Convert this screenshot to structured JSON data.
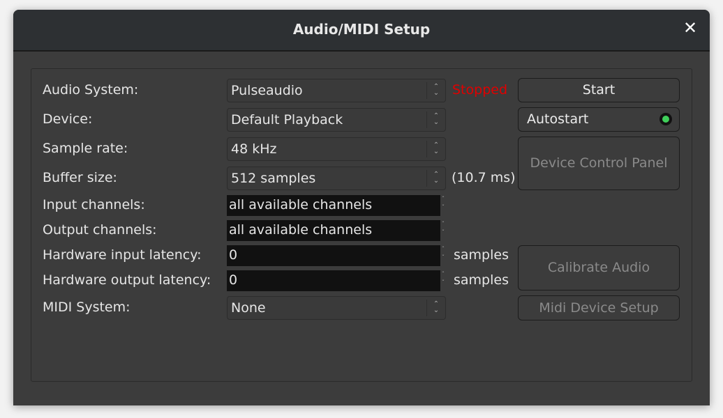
{
  "window": {
    "title": "Audio/MIDI Setup",
    "close_icon": "close-icon"
  },
  "form": {
    "audio_system": {
      "label": "Audio System:",
      "value": "Pulseaudio"
    },
    "status": {
      "text": "Stopped",
      "color": "#e00000"
    },
    "device": {
      "label": "Device:",
      "value": "Default Playback"
    },
    "sample_rate": {
      "label": "Sample rate:",
      "value": "48 kHz"
    },
    "buffer_size": {
      "label": "Buffer size:",
      "value": "512 samples",
      "latency": "(10.7 ms)"
    },
    "input_channels": {
      "label": "Input channels:",
      "value": "all available channels"
    },
    "output_channels": {
      "label": "Output channels:",
      "value": "all available channels"
    },
    "hw_input_latency": {
      "label": "Hardware input latency:",
      "value": "0",
      "unit": "samples"
    },
    "hw_output_latency": {
      "label": "Hardware output latency:",
      "value": "0",
      "unit": "samples"
    },
    "midi_system": {
      "label": "MIDI System:",
      "value": "None"
    }
  },
  "buttons": {
    "start": "Start",
    "autostart": "Autostart",
    "autostart_led_color": "#3fcf5a",
    "device_control_panel": "Device Control Panel",
    "calibrate_audio": "Calibrate Audio",
    "midi_device_setup": "Midi Device Setup"
  }
}
